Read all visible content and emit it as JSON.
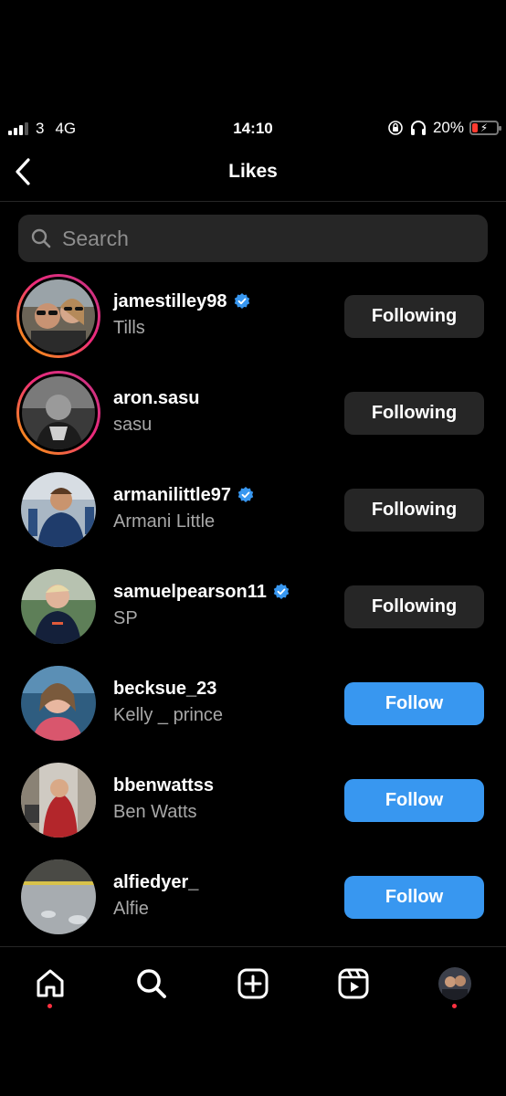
{
  "status_bar": {
    "carrier": "3",
    "network": "4G",
    "time": "14:10",
    "battery": "20%",
    "battery_level": 0.2,
    "battery_color": "#ff3b30"
  },
  "header": {
    "title": "Likes",
    "back_icon": "chevron-left-icon"
  },
  "search": {
    "placeholder": "Search",
    "value": "",
    "icon": "search-icon"
  },
  "likes": [
    {
      "username": "jamestilley98",
      "name": "Tills",
      "verified": true,
      "story_ring": true,
      "button": "Following",
      "button_type": "following"
    },
    {
      "username": "aron.sasu",
      "name": "sasu",
      "verified": false,
      "story_ring": true,
      "button": "Following",
      "button_type": "following"
    },
    {
      "username": "armanilittle97",
      "name": "Armani Little",
      "verified": true,
      "story_ring": false,
      "button": "Following",
      "button_type": "following"
    },
    {
      "username": "samuelpearson11",
      "name": "SP",
      "verified": true,
      "story_ring": false,
      "button": "Following",
      "button_type": "following"
    },
    {
      "username": "becksue_23",
      "name": "Kelly _ prince",
      "verified": false,
      "story_ring": false,
      "button": "Follow",
      "button_type": "follow"
    },
    {
      "username": "bbenwattss",
      "name": "Ben Watts",
      "verified": false,
      "story_ring": false,
      "button": "Follow",
      "button_type": "follow"
    },
    {
      "username": "alfiedyer_",
      "name": "Alfie",
      "verified": false,
      "story_ring": false,
      "button": "Follow",
      "button_type": "follow"
    }
  ],
  "tab_bar": {
    "tabs": [
      {
        "icon": "home-icon",
        "notification_dot": true
      },
      {
        "icon": "search-icon",
        "notification_dot": false
      },
      {
        "icon": "create-post-icon",
        "notification_dot": false
      },
      {
        "icon": "reels-icon",
        "notification_dot": false
      },
      {
        "icon": "profile-avatar",
        "notification_dot": true
      }
    ]
  },
  "colors": {
    "background": "#000000",
    "follow_button": "#3897f0",
    "following_button": "#262626",
    "verified_badge": "#3897f0",
    "secondary_text": "#a8a8a8",
    "notification_dot": "#ff3040"
  }
}
